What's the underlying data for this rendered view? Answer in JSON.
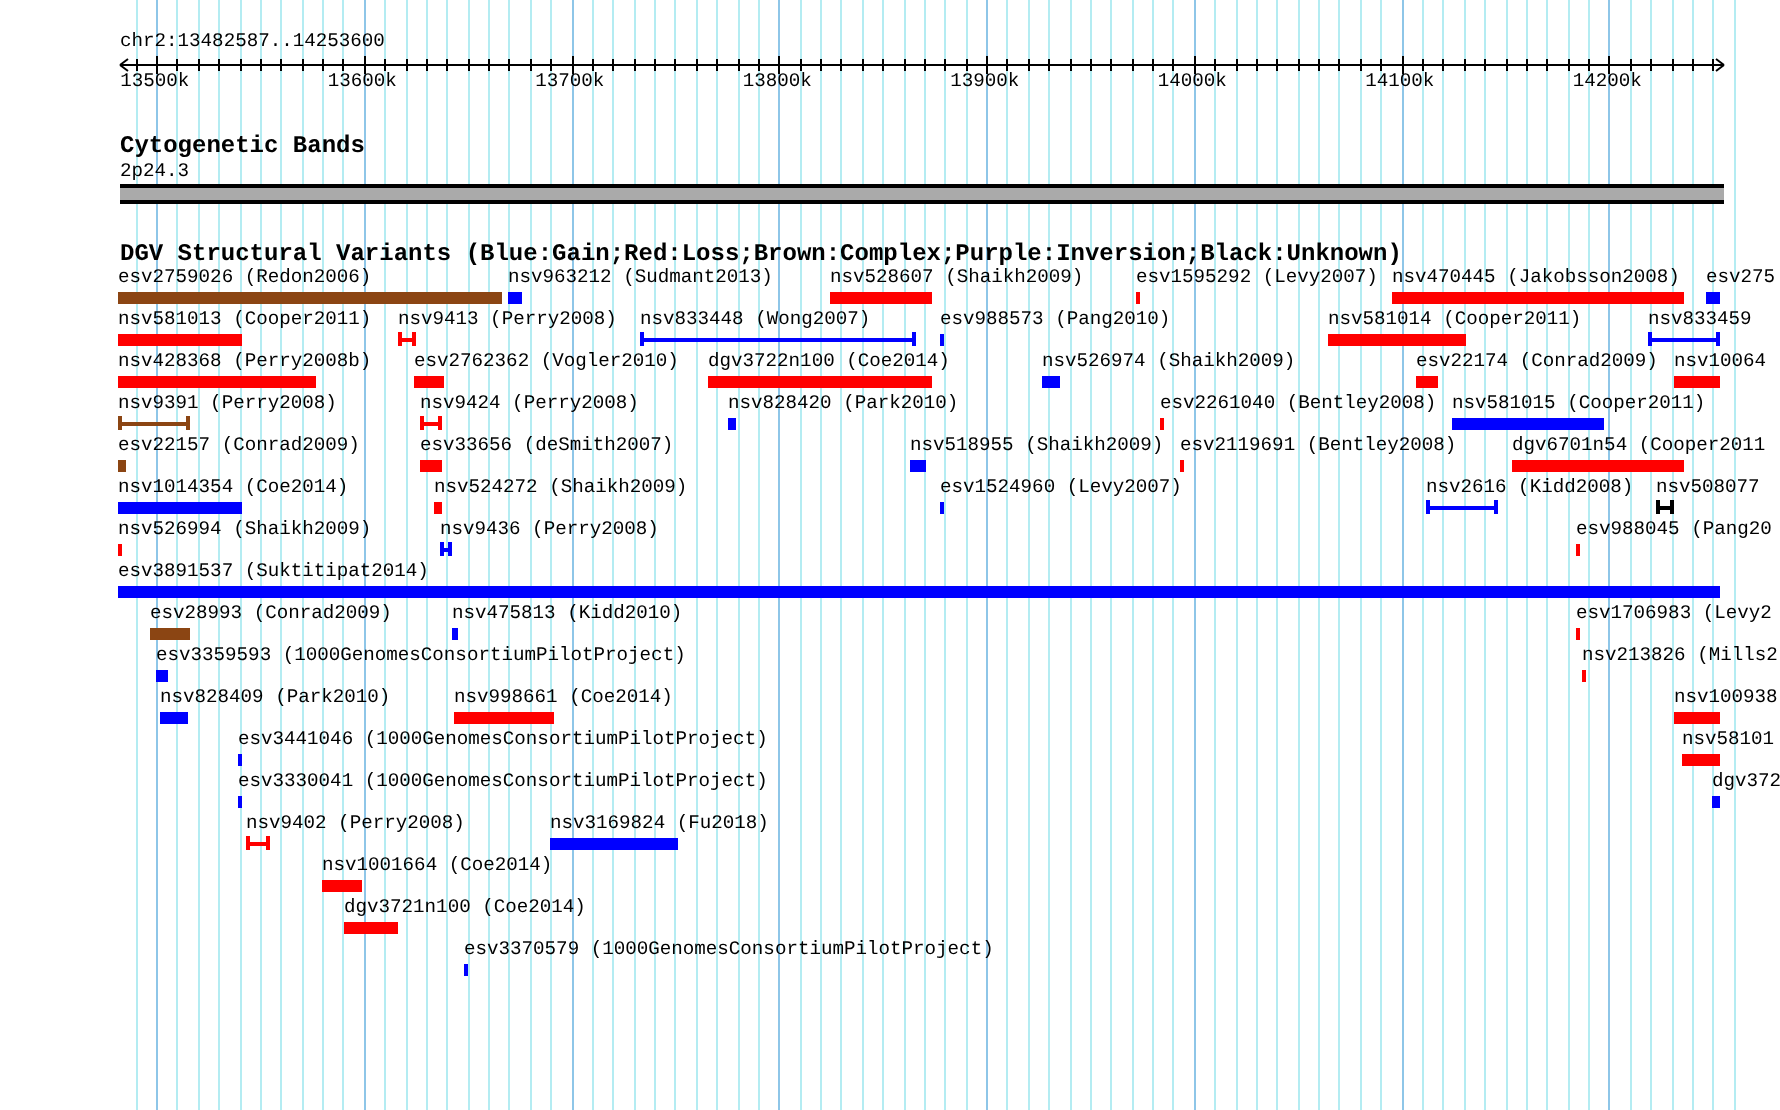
{
  "ruler": {
    "range": "chr2:13482587..14253600",
    "ticks": [
      {
        "label": "13500k"
      },
      {
        "label": "13600k"
      },
      {
        "label": "13700k"
      },
      {
        "label": "13800k"
      },
      {
        "label": "13900k"
      },
      {
        "label": "14000k"
      },
      {
        "label": "14100k"
      },
      {
        "label": "14200k"
      }
    ]
  },
  "cytoband_track": {
    "title": "Cytogenetic Bands",
    "band": "2p24.3"
  },
  "variant_track": {
    "title": "DGV Structural Variants (Blue:Gain;Red:Loss;Brown:Complex;Purple:Inversion;Black:Unknown)",
    "lanes": [
      {
        "features": [
          {
            "label": "esv2759026 (Redon2006)",
            "color": "#8b4513",
            "kind": "bar"
          },
          {
            "label": "nsv963212 (Sudmant2013)",
            "color": "#0000ff",
            "kind": "bar"
          },
          {
            "label": "nsv528607 (Shaikh2009)",
            "color": "#ff0000",
            "kind": "bar"
          },
          {
            "label": "esv1595292 (Levy2007)",
            "color": "#ff0000",
            "kind": "bar"
          },
          {
            "label": "nsv470445 (Jakobsson2008)",
            "color": "#ff0000",
            "kind": "bar"
          },
          {
            "label": "esv275",
            "color": "#0000ff",
            "kind": "bar"
          }
        ]
      },
      {
        "features": [
          {
            "label": "nsv581013 (Cooper2011)",
            "color": "#ff0000",
            "kind": "bar"
          },
          {
            "label": "nsv9413 (Perry2008)",
            "color": "#ff0000",
            "kind": "ibeam"
          },
          {
            "label": "nsv833448 (Wong2007)",
            "color": "#0000ff",
            "kind": "line"
          },
          {
            "label": "esv988573 (Pang2010)",
            "color": "#0000ff",
            "kind": "bar"
          },
          {
            "label": "nsv581014 (Cooper2011)",
            "color": "#ff0000",
            "kind": "bar"
          },
          {
            "label": "nsv833459",
            "color": "#0000ff",
            "kind": "line"
          }
        ]
      },
      {
        "features": [
          {
            "label": "nsv428368 (Perry2008b)",
            "color": "#ff0000",
            "kind": "bar"
          },
          {
            "label": "esv2762362 (Vogler2010)",
            "color": "#ff0000",
            "kind": "bar"
          },
          {
            "label": "dgv3722n100 (Coe2014)",
            "color": "#ff0000",
            "kind": "bar"
          },
          {
            "label": "nsv526974 (Shaikh2009)",
            "color": "#0000ff",
            "kind": "bar"
          },
          {
            "label": "esv22174 (Conrad2009)",
            "color": "#ff0000",
            "kind": "bar"
          },
          {
            "label": "nsv10064",
            "color": "#ff0000",
            "kind": "bar"
          }
        ]
      },
      {
        "features": [
          {
            "label": "nsv9391 (Perry2008)",
            "color": "#8b4513",
            "kind": "line"
          },
          {
            "label": "nsv9424 (Perry2008)",
            "color": "#ff0000",
            "kind": "ibeam"
          },
          {
            "label": "nsv828420 (Park2010)",
            "color": "#0000ff",
            "kind": "bar"
          },
          {
            "label": "esv2261040 (Bentley2008)",
            "color": "#ff0000",
            "kind": "bar"
          },
          {
            "label": "nsv581015 (Cooper2011)",
            "color": "#0000ff",
            "kind": "bar"
          }
        ]
      },
      {
        "features": [
          {
            "label": "esv22157 (Conrad2009)",
            "color": "#8b4513",
            "kind": "bar"
          },
          {
            "label": "esv33656 (deSmith2007)",
            "color": "#ff0000",
            "kind": "bar"
          },
          {
            "label": "nsv518955 (Shaikh2009)",
            "color": "#0000ff",
            "kind": "bar"
          },
          {
            "label": "esv2119691 (Bentley2008)",
            "color": "#ff0000",
            "kind": "bar"
          },
          {
            "label": "dgv6701n54 (Cooper2011",
            "color": "#ff0000",
            "kind": "bar"
          }
        ]
      },
      {
        "features": [
          {
            "label": "nsv1014354 (Coe2014)",
            "color": "#0000ff",
            "kind": "bar"
          },
          {
            "label": "nsv524272 (Shaikh2009)",
            "color": "#ff0000",
            "kind": "bar"
          },
          {
            "label": "esv1524960 (Levy2007)",
            "color": "#0000ff",
            "kind": "bar"
          },
          {
            "label": "nsv2616 (Kidd2008)",
            "color": "#0000ff",
            "kind": "line"
          },
          {
            "label": "nsv508077",
            "color": "#000000",
            "kind": "ibeam"
          }
        ]
      },
      {
        "features": [
          {
            "label": "nsv526994 (Shaikh2009)",
            "color": "#ff0000",
            "kind": "bar"
          },
          {
            "label": "nsv9436 (Perry2008)",
            "color": "#0000ff",
            "kind": "ibeam"
          },
          {
            "label": "esv988045 (Pang20",
            "color": "#ff0000",
            "kind": "bar"
          }
        ]
      },
      {
        "features": [
          {
            "label": "esv3891537 (Suktitipat2014)",
            "color": "#0000ff",
            "kind": "bar"
          }
        ]
      },
      {
        "features": [
          {
            "label": "esv28993 (Conrad2009)",
            "color": "#8b4513",
            "kind": "bar"
          },
          {
            "label": "nsv475813 (Kidd2010)",
            "color": "#0000ff",
            "kind": "bar"
          },
          {
            "label": "esv1706983 (Levy2",
            "color": "#ff0000",
            "kind": "bar"
          }
        ]
      },
      {
        "features": [
          {
            "label": "esv3359593 (1000GenomesConsortiumPilotProject)",
            "color": "#0000ff",
            "kind": "bar"
          },
          {
            "label": "nsv213826 (Mills2",
            "color": "#ff0000",
            "kind": "bar"
          }
        ]
      },
      {
        "features": [
          {
            "label": "nsv828409 (Park2010)",
            "color": "#0000ff",
            "kind": "bar"
          },
          {
            "label": "nsv998661 (Coe2014)",
            "color": "#ff0000",
            "kind": "bar"
          },
          {
            "label": "nsv100938",
            "color": "#ff0000",
            "kind": "bar"
          }
        ]
      },
      {
        "features": [
          {
            "label": "esv3441046 (1000GenomesConsortiumPilotProject)",
            "color": "#0000ff",
            "kind": "bar"
          },
          {
            "label": "nsv58101",
            "color": "#ff0000",
            "kind": "bar"
          }
        ]
      },
      {
        "features": [
          {
            "label": "esv3330041 (1000GenomesConsortiumPilotProject)",
            "color": "#0000ff",
            "kind": "bar"
          },
          {
            "label": "dgv372",
            "color": "#0000ff",
            "kind": "bar"
          }
        ]
      },
      {
        "features": [
          {
            "label": "nsv9402 (Perry2008)",
            "color": "#ff0000",
            "kind": "ibeam"
          },
          {
            "label": "nsv3169824 (Fu2018)",
            "color": "#0000ff",
            "kind": "bar"
          }
        ]
      },
      {
        "features": [
          {
            "label": "nsv1001664 (Coe2014)",
            "color": "#ff0000",
            "kind": "bar"
          }
        ]
      },
      {
        "features": [
          {
            "label": "dgv3721n100 (Coe2014)",
            "color": "#ff0000",
            "kind": "bar"
          }
        ]
      },
      {
        "features": [
          {
            "label": "esv3370579 (1000GenomesConsortiumPilotProject)",
            "color": "#0000ff",
            "kind": "bar"
          }
        ]
      }
    ]
  }
}
